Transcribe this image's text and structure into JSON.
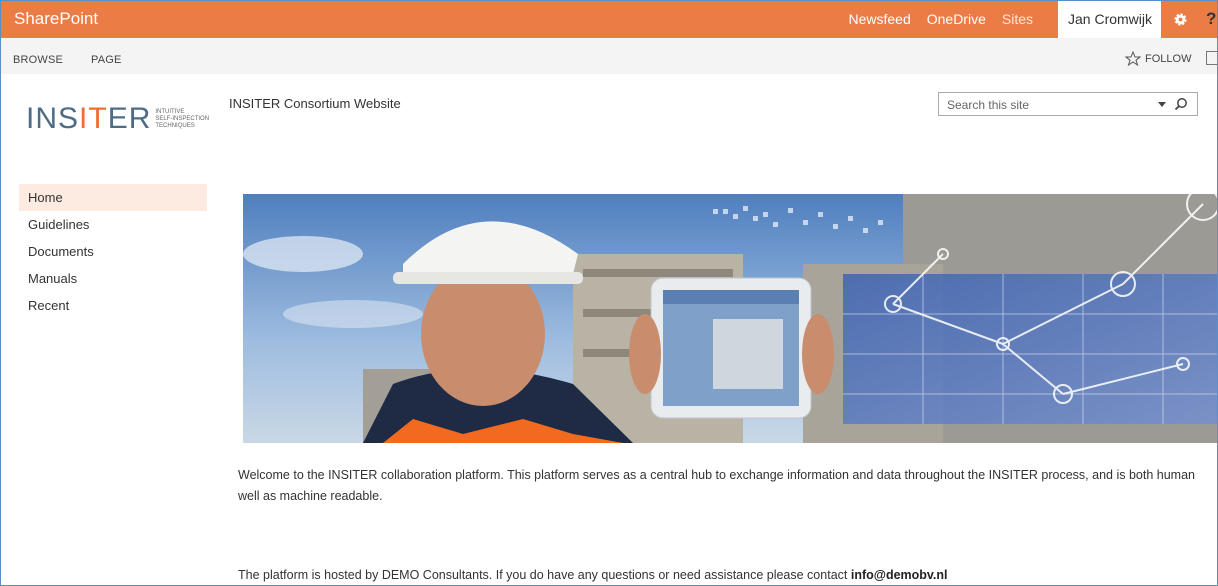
{
  "suite": {
    "brand": "SharePoint",
    "links": [
      "Newsfeed",
      "OneDrive",
      "Sites"
    ],
    "user": "Jan Cromwijk",
    "help": "?"
  },
  "ribbon": {
    "tabs": [
      "BROWSE",
      "PAGE"
    ],
    "follow": "FOLLOW"
  },
  "header": {
    "logo_text_a": "INS",
    "logo_text_b": "IT",
    "logo_text_c": "ER",
    "logo_tagline": [
      "INTUITIVE",
      "SELF-INSPECTION",
      "TECHNIQUES"
    ],
    "site_title": "INSITER Consortium Website",
    "search_placeholder": "Search this site"
  },
  "leftnav": {
    "items": [
      "Home",
      "Guidelines",
      "Documents",
      "Manuals",
      "Recent"
    ],
    "selected": "Home"
  },
  "content": {
    "welcome_line1": "Welcome to the INSITER collaboration platform. This platform serves as a central hub to exchange information and data throughout the INSITER process, and is both human",
    "welcome_line2": "well as machine readable.",
    "hosted_text": "The platform is hosted by DEMO Consultants. If you do have any questions or need assistance please contact ",
    "contact_email": "info@demobv.nl"
  },
  "colors": {
    "suitebar": "#ec7c45",
    "nav_selected_bg": "#fdebe2",
    "logo_blue": "#4e6c86",
    "logo_orange": "#ec6d35"
  },
  "icons": [
    "gear-icon",
    "star-icon",
    "focus-icon",
    "search-icon",
    "caret-icon"
  ]
}
